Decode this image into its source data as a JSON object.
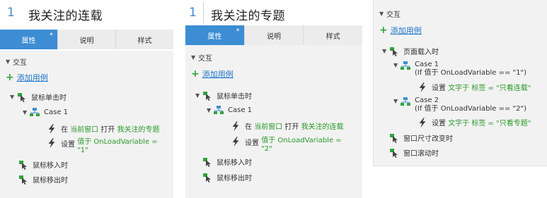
{
  "panels": [
    {
      "page_number": "1",
      "page_title": "我关注的连载",
      "tabs": {
        "properties": "属性",
        "properties_star": "*",
        "notes": "说明",
        "style": "样式"
      },
      "section": "交互",
      "add_case": "添加用例",
      "events": {
        "click": "鼠标单击时",
        "case": "Case 1",
        "action1": {
          "prefix": "在",
          "target": "当前窗口",
          "verb": "打开",
          "page": "我关注的专题"
        },
        "action2": {
          "prefix": "设置",
          "line1": "值于 OnLoadVariable =",
          "line2": "\"1\""
        },
        "enter": "鼠标移入时",
        "leave": "鼠标移出时"
      }
    },
    {
      "page_number": "1",
      "page_title": "我关注的专题",
      "tabs": {
        "properties": "属性",
        "properties_star": "*",
        "notes": "说明",
        "style": "样式"
      },
      "section": "交互",
      "add_case": "添加用例",
      "events": {
        "click": "鼠标单击时",
        "case": "Case 1",
        "action1": {
          "prefix": "在",
          "target": "当前窗口",
          "verb": "打开",
          "page": "我关注的连载"
        },
        "action2": {
          "prefix": "设置",
          "line1": "值于 OnLoadVariable =",
          "line2": "\"2\""
        },
        "enter": "鼠标移入时",
        "leave": "鼠标移出时"
      }
    }
  ],
  "panel3": {
    "section": "交互",
    "add_case": "添加用例",
    "page_load": "页面载入时",
    "case1": {
      "name": "Case 1",
      "cond": "(If 值于 OnLoadVariable == \"1\")",
      "set": "设置",
      "detail": "文字于 标签 = \"只看连载\""
    },
    "case2": {
      "name": "Case 2",
      "cond": "(If 值于 OnLoadVariable == \"2\")",
      "set": "设置",
      "detail": "文字于 标签 = \"只看专题\""
    },
    "resize": "窗口尺寸改变时",
    "scroll": "窗口滚动时"
  },
  "colors": {
    "accent": "#3c8dd4",
    "link": "#1a74c9",
    "green_value": "#2a9a2a",
    "add_plus": "#2fa43e"
  },
  "icons": [
    "cursor-event-icon",
    "case-tree-icon",
    "lightning-action-icon",
    "plus-icon"
  ]
}
